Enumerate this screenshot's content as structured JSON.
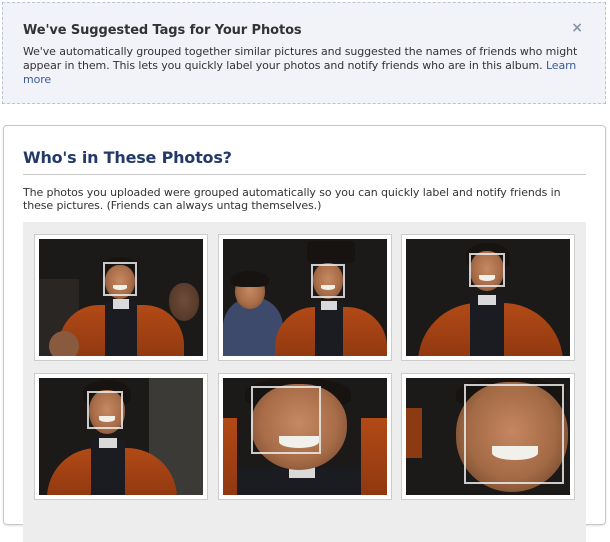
{
  "notice": {
    "title": "We've Suggested Tags for Your Photos",
    "text": "We've automatically grouped together similar pictures and suggested the names of friends who might appear in them. This lets you quickly label your photos and notify friends who are in this album.",
    "link_label": "Learn more",
    "close_glyph": "×"
  },
  "panel": {
    "title": "Who's in These Photos?",
    "description": "The photos you uploaded were grouped automatically so you can quickly label and notify friends in these pictures. (Friends can always untag themselves.)"
  },
  "colors": {
    "notice_bg": "#f1f3f8",
    "title_blue": "#233a69",
    "link_blue": "#3b5998",
    "gown_orange": "#b24a16"
  },
  "photos": [
    {
      "id": "photo-1"
    },
    {
      "id": "photo-2"
    },
    {
      "id": "photo-3"
    },
    {
      "id": "photo-4"
    },
    {
      "id": "photo-5"
    },
    {
      "id": "photo-6"
    }
  ]
}
